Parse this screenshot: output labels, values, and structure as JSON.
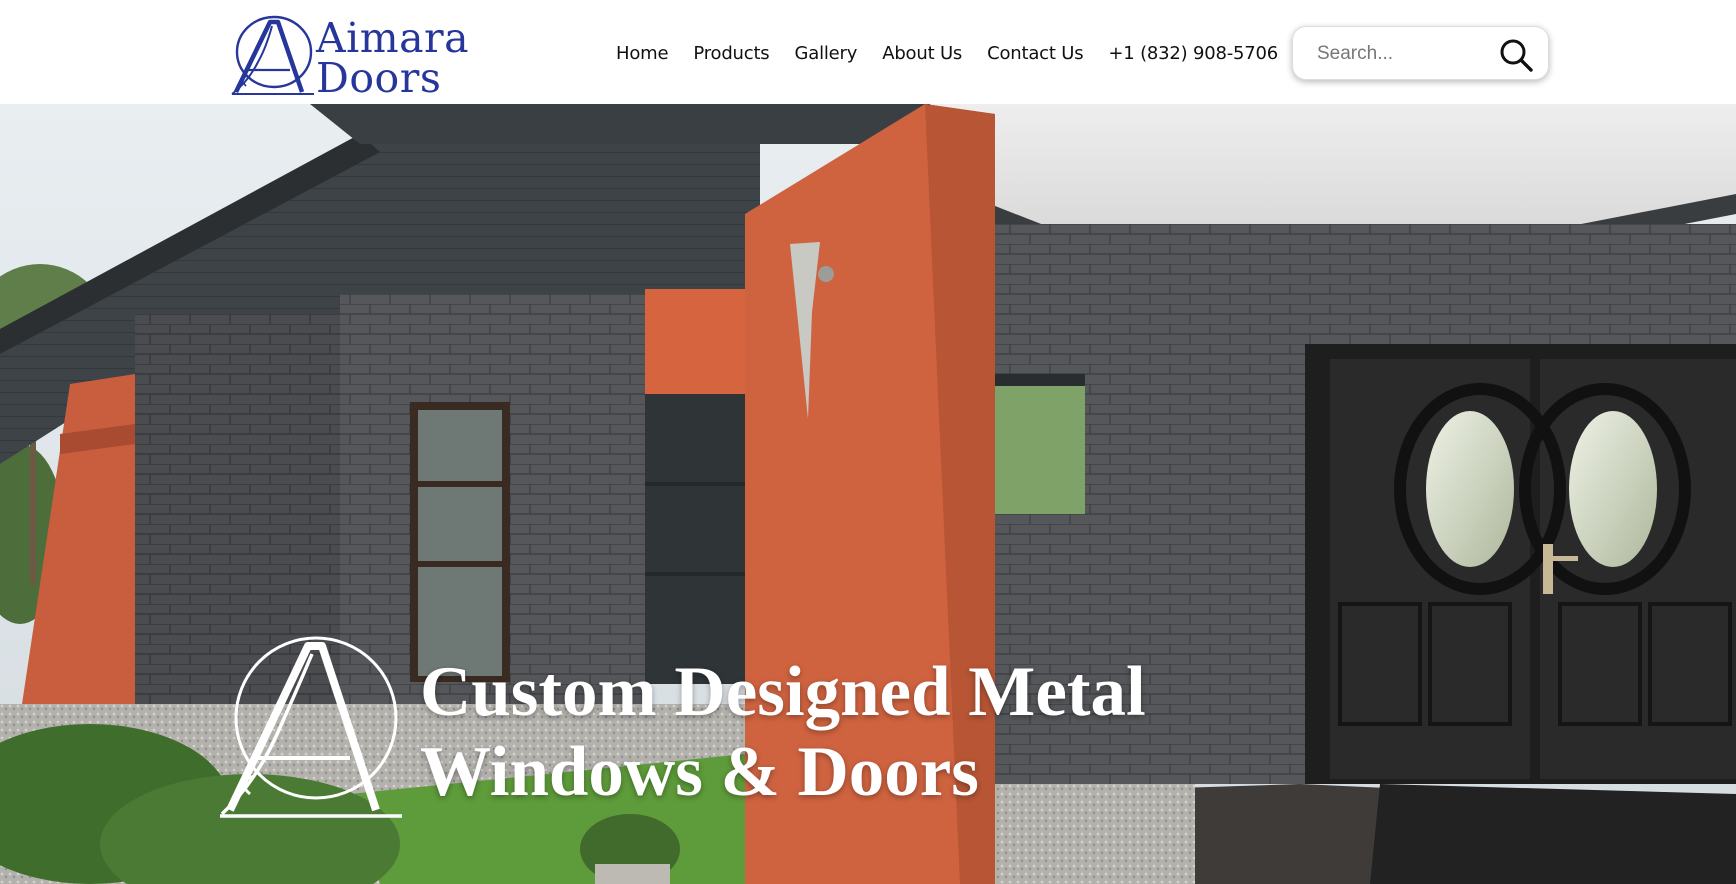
{
  "brand": {
    "logo_line1": "Aimara",
    "logo_line2": "Doors",
    "color": "#26369a"
  },
  "nav": {
    "items": [
      {
        "label": "Home"
      },
      {
        "label": "Products"
      },
      {
        "label": "Gallery"
      },
      {
        "label": "About Us"
      },
      {
        "label": "Contact Us"
      }
    ],
    "phone": "+1 (832) 908-5706"
  },
  "search": {
    "placeholder": "Search...",
    "icon": "search-icon"
  },
  "hero": {
    "title_line1": "Custom Designed Metal",
    "title_line2": "Windows & Doors",
    "mark_icon": "aimara-monogram-icon"
  }
}
